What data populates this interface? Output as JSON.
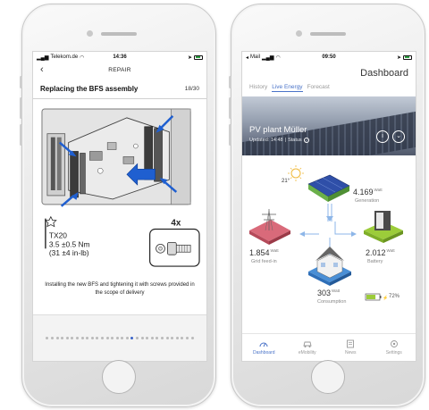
{
  "left_phone": {
    "status": {
      "carrier": "Telekom.de",
      "time": "14:36"
    },
    "nav": {
      "back_glyph": "‹",
      "title": "REPAIR"
    },
    "step": {
      "title": "Replacing the BFS assembly",
      "counter": "18/30"
    },
    "illustration": {
      "tool": "TX20",
      "torque_nm": "3.5 ±0.5 Nm",
      "torque_inlb": "(31 ±4 in-lb)",
      "quantity": "4x"
    },
    "caption": "Installing the new BFS and tightening it with screws provided in the scope of delivery",
    "pager": {
      "total": 30,
      "active_index": 17
    }
  },
  "right_phone": {
    "status": {
      "carrier": "Mail",
      "time": "09:50"
    },
    "title": "Dashboard",
    "tabs": [
      {
        "label": "History",
        "active": false
      },
      {
        "label": "Live Energy",
        "active": true
      },
      {
        "label": "Forecast",
        "active": false
      }
    ],
    "plant": {
      "name": "PV plant Müller",
      "updated": "Updated: 14:48",
      "status_label": "Status"
    },
    "weather": {
      "temperature": "21°"
    },
    "generation": {
      "value": "4.169",
      "unit": "Watt",
      "label": "Generation"
    },
    "grid": {
      "value": "1.854",
      "unit": "Watt",
      "label": "Grid feed-in"
    },
    "battery": {
      "value": "2.012",
      "unit": "Watt",
      "label": "Battery",
      "charge": "72%",
      "charge_fraction": 0.72
    },
    "consumption": {
      "value": "303",
      "unit": "Watt",
      "label": "Consumption"
    },
    "tabbar": [
      {
        "label": "Dashboard",
        "icon": "dashboard-icon",
        "active": true
      },
      {
        "label": "eMobility",
        "icon": "car-icon",
        "active": false
      },
      {
        "label": "News",
        "icon": "news-icon",
        "active": false
      },
      {
        "label": "Settings",
        "icon": "settings-icon",
        "active": false
      }
    ],
    "colors": {
      "accent": "#4a73c8",
      "battery": "#9ccc3a"
    }
  }
}
